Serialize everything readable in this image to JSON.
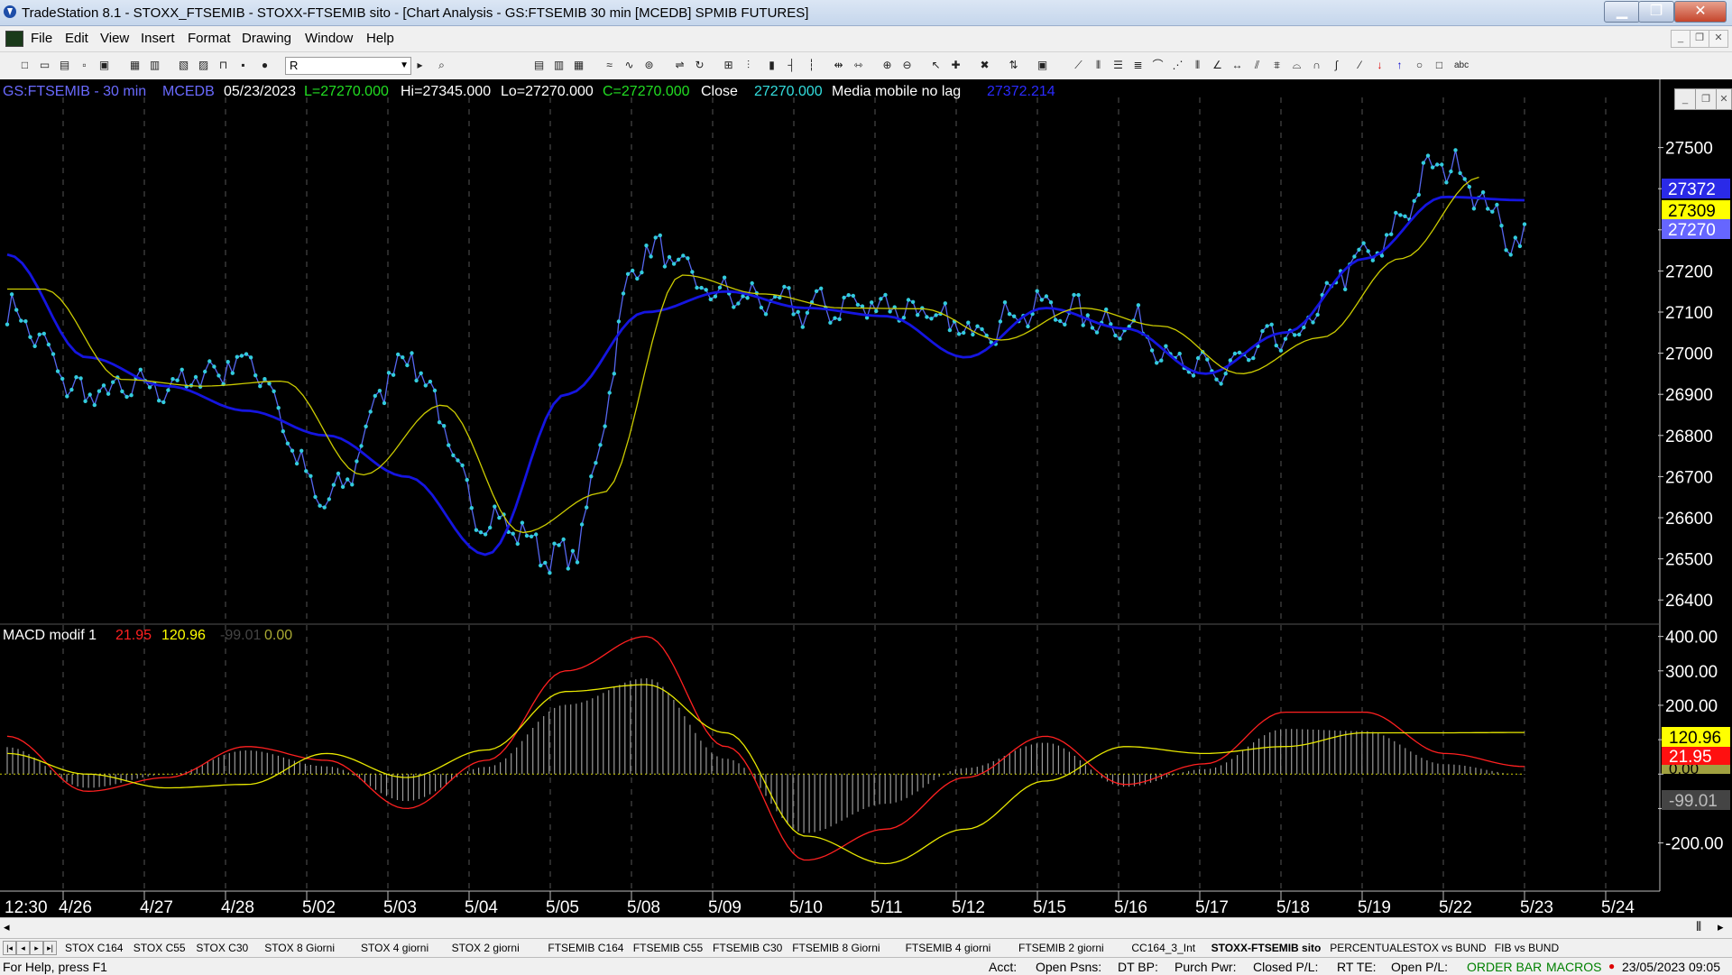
{
  "window": {
    "title": "TradeStation 8.1 - STOXX_FTSEMIB - STOXX-FTSEMIB sito - [Chart Analysis - GS:FTSEMIB  30 min  [MCEDB] SPMIB FUTURES]",
    "min": "▁",
    "max": "❐",
    "close": "✕"
  },
  "menu": {
    "file": "File",
    "edit": "Edit",
    "view": "View",
    "insert": "Insert",
    "format": "Format",
    "drawing": "Drawing",
    "window": "Window",
    "help": "Help"
  },
  "toolbar": {
    "symbol_value": "R"
  },
  "chart_header": {
    "symbol": "GS:FTSEMIB - 30 min",
    "exchange": "MCEDB",
    "date": "05/23/2023",
    "last": "L=27270.000",
    "high": "Hi=27345.000",
    "low": "Lo=27270.000",
    "close": "C=27270.000",
    "close_label": "Close",
    "close_value": "27270.000",
    "ma_label": "Media mobile no lag",
    "ma_value": "27372.214"
  },
  "macd_header": {
    "label": "MACD modif 1",
    "v1": "21.95",
    "v2": "120.96",
    "v3": "-99.01",
    "v4": "0.00"
  },
  "price_axis": [
    "27500",
    "27400",
    "27300",
    "27200",
    "27100",
    "27000",
    "26900",
    "26800",
    "26700",
    "26600",
    "26500",
    "26400"
  ],
  "price_tags": {
    "blue": "27372",
    "yellow": "27309",
    "purple": "27270"
  },
  "macd_axis": [
    "400.00",
    "300.00",
    "200.00",
    "100.00",
    "0.00",
    "-100.00",
    "-200.00"
  ],
  "macd_tags": {
    "yellow": "120.96",
    "red": "21.95",
    "zero": "0.00",
    "gray": "-99.01"
  },
  "date_axis": [
    "12:30",
    "4/26",
    "4/27",
    "4/28",
    "5/02",
    "5/03",
    "5/04",
    "5/05",
    "5/08",
    "5/09",
    "5/10",
    "5/11",
    "5/12",
    "5/15",
    "5/16",
    "5/17",
    "5/18",
    "5/19",
    "5/22",
    "5/23",
    "5/24"
  ],
  "colors": {
    "price": "#33ccdd",
    "price_line": "#5566ee",
    "ma_blue": "#1515e0",
    "ma_yellow": "#cccc00",
    "macd": "#ff2020",
    "signal": "#e8e800",
    "hist": "#9a9a9a",
    "axis_text": "#ffffff"
  },
  "tabs": [
    "STOX C164",
    "STOX C55",
    "STOX  C30",
    "STOX  8 Giorni",
    "STOX 4 giorni",
    "STOX  2 giorni",
    "FTSEMIB C164",
    "FTSEMIB C55",
    "FTSEMIB C30",
    "FTSEMIB  8 Giorni",
    "FTSEMIB  4 giorni",
    "FTSEMIB  2 giorni",
    "CC164_3_Int",
    "STOXX-FTSEMIB sito",
    "PERCENTUALE",
    "STOX vs BUND",
    "FIB vs BUND"
  ],
  "status": {
    "help": "For Help, press F1",
    "acct": "Acct:",
    "open_psns": "Open Psns:",
    "dt_bp": "DT BP:",
    "purch_pwr": "Purch Pwr:",
    "closed_pl": "Closed P/L:",
    "rt_te": "RT TE:",
    "open_pl": "Open P/L:",
    "order_bar": "ORDER BAR",
    "macros": "MACROS",
    "datetime": "23/05/2023 09:05"
  },
  "chart_data": [
    {
      "type": "line",
      "title": "GS:FTSEMIB - 30 min",
      "ylim": [
        26350,
        27600
      ],
      "x_categories": [
        "12:30",
        "4/26",
        "4/27",
        "4/28",
        "5/02",
        "5/03",
        "5/04",
        "5/05",
        "5/08",
        "5/09",
        "5/10",
        "5/11",
        "5/12",
        "5/15",
        "5/16",
        "5/17",
        "5/18",
        "5/19",
        "5/22",
        "5/23"
      ],
      "series": [
        {
          "name": "Close",
          "values": [
            27100,
            26900,
            26920,
            26980,
            26640,
            26990,
            26600,
            26500,
            27250,
            27140,
            27110,
            27120,
            27060,
            27110,
            27070,
            26950,
            27030,
            27230,
            27460,
            27270
          ]
        },
        {
          "name": "Media mobile no lag",
          "values": [
            27240,
            26990,
            26920,
            26860,
            26800,
            26700,
            26510,
            26900,
            27100,
            27150,
            27110,
            27090,
            26990,
            27110,
            27060,
            26950,
            27050,
            27230,
            27380,
            27372
          ]
        }
      ]
    },
    {
      "type": "line",
      "title": "MACD modif 1",
      "ylim": [
        -340,
        420
      ],
      "x_categories": [
        "12:30",
        "4/26",
        "4/27",
        "4/28",
        "5/02",
        "5/03",
        "5/04",
        "5/05",
        "5/08",
        "5/09",
        "5/10",
        "5/11",
        "5/12",
        "5/15",
        "5/16",
        "5/17",
        "5/18",
        "5/19",
        "5/22",
        "5/23"
      ],
      "series": [
        {
          "values": [
            110,
            -50,
            -10,
            80,
            40,
            -100,
            40,
            300,
            400,
            80,
            -250,
            -160,
            -10,
            110,
            -30,
            30,
            180,
            180,
            60,
            22
          ]
        },
        {
          "values": [
            60,
            0,
            -40,
            -30,
            60,
            -10,
            70,
            240,
            260,
            120,
            -180,
            -260,
            -160,
            -20,
            80,
            60,
            80,
            120,
            120,
            121
          ]
        }
      ]
    }
  ]
}
